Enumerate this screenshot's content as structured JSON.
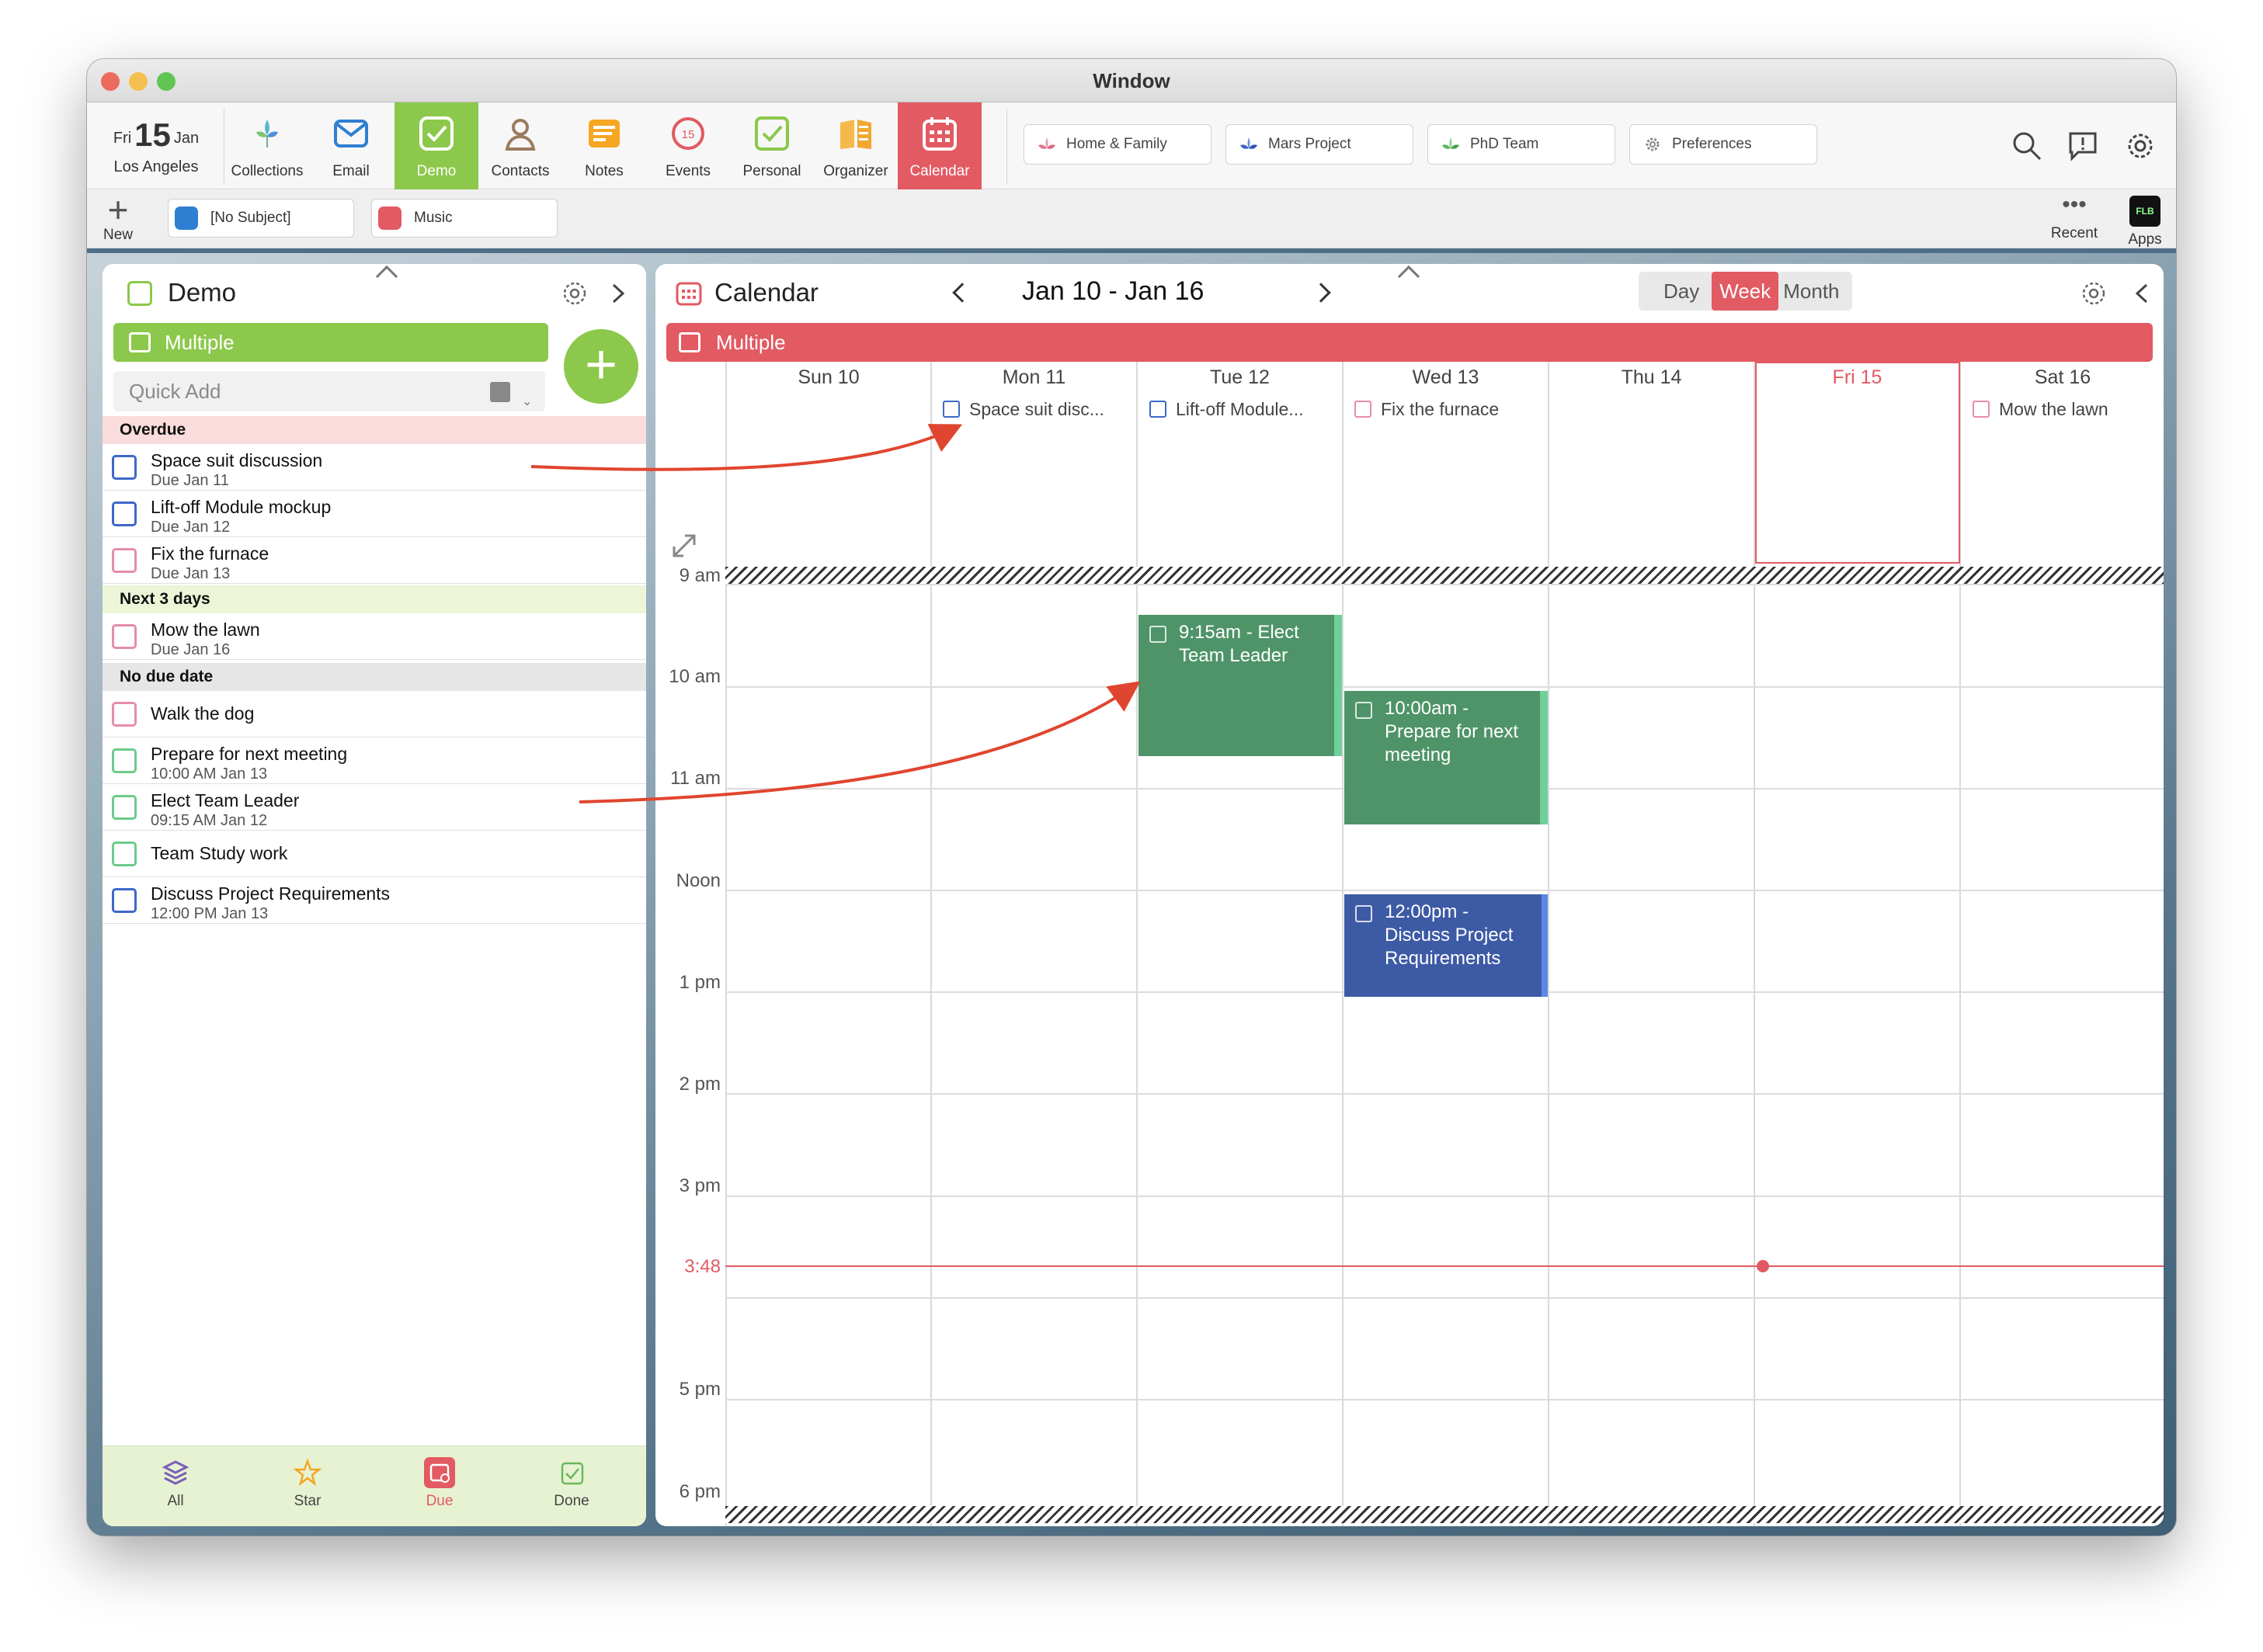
{
  "window": {
    "title": "Window"
  },
  "toolbar": {
    "date": {
      "weekday": "Fri",
      "day": "15",
      "month": "Jan",
      "city": "Los Angeles"
    },
    "items": [
      {
        "label": "Collections",
        "icon": "collections-icon"
      },
      {
        "label": "Email",
        "icon": "email-icon"
      },
      {
        "label": "Demo",
        "icon": "demo-check-icon",
        "active": true
      },
      {
        "label": "Contacts",
        "icon": "contacts-icon"
      },
      {
        "label": "Notes",
        "icon": "notes-icon"
      },
      {
        "label": "Events",
        "icon": "events-icon",
        "badge": "15"
      },
      {
        "label": "Personal",
        "icon": "personal-check-icon"
      },
      {
        "label": "Organizer",
        "icon": "organizer-icon"
      },
      {
        "label": "Calendar",
        "icon": "calendar-icon",
        "active": true
      }
    ],
    "collections": [
      {
        "label": "Home & Family"
      },
      {
        "label": "Mars Project"
      },
      {
        "label": "PhD Team"
      },
      {
        "label": "Preferences"
      }
    ]
  },
  "bar2": {
    "new_label": "New",
    "tabs": [
      {
        "label": "[No Subject]"
      },
      {
        "label": "Music"
      }
    ],
    "recent_label": "Recent",
    "apps_label": "Apps",
    "apps_icon_text": "FLB"
  },
  "left": {
    "title": "Demo",
    "multiple_label": "Multiple",
    "quick_add_placeholder": "Quick Add",
    "sections": {
      "overdue": "Overdue",
      "next3": "Next 3 days",
      "nodue": "No due date"
    },
    "tasks": [
      {
        "title": "Space suit discussion",
        "sub": "Due Jan 11"
      },
      {
        "title": "Lift-off Module mockup",
        "sub": "Due Jan 12"
      },
      {
        "title": "Fix the furnace",
        "sub": "Due Jan 13"
      },
      {
        "title": "Mow the lawn",
        "sub": "Due Jan 16"
      },
      {
        "title": "Walk the dog",
        "sub": ""
      },
      {
        "title": "Prepare for next meeting",
        "sub": "10:00 AM Jan 13"
      },
      {
        "title": "Elect Team Leader",
        "sub": "09:15 AM Jan 12"
      },
      {
        "title": "Team Study work",
        "sub": ""
      },
      {
        "title": "Discuss Project Requirements",
        "sub": "12:00 PM Jan 13"
      }
    ],
    "footer": [
      {
        "label": "All"
      },
      {
        "label": "Star"
      },
      {
        "label": "Due"
      },
      {
        "label": "Done"
      }
    ]
  },
  "calendar": {
    "title": "Calendar",
    "range": "Jan 10 - Jan 16",
    "views": [
      "Day",
      "Week",
      "Month"
    ],
    "active_view": "Week",
    "multiple_label": "Multiple",
    "days": [
      "Sun 10",
      "Mon 11",
      "Tue 12",
      "Wed 13",
      "Thu 14",
      "Fri 15",
      "Sat 16"
    ],
    "today": "Fri 15",
    "allday": [
      {
        "day": "Mon 11",
        "label": "Space suit disc..."
      },
      {
        "day": "Tue 12",
        "label": "Lift-off Module..."
      },
      {
        "day": "Wed 13",
        "label": "Fix the furnace"
      },
      {
        "day": "Sat 16",
        "label": "Mow the lawn"
      }
    ],
    "hours": [
      "9 am",
      "10 am",
      "11 am",
      "Noon",
      "1 pm",
      "2 pm",
      "3 pm",
      "5 pm",
      "6 pm"
    ],
    "now_label": "3:48",
    "events": [
      {
        "label": "9:15am - Elect Team Leader",
        "day": "Tue 12"
      },
      {
        "label": "10:00am - Prepare for next meeting",
        "day": "Wed 13"
      },
      {
        "label": "12:00pm - Discuss Project Requirements",
        "day": "Wed 13"
      }
    ]
  },
  "colors": {
    "green": "#8cc84b",
    "red": "#e25a62",
    "event_green": "#4e9468",
    "event_blue": "#3d5aa5",
    "arrow": "#e0452f"
  }
}
